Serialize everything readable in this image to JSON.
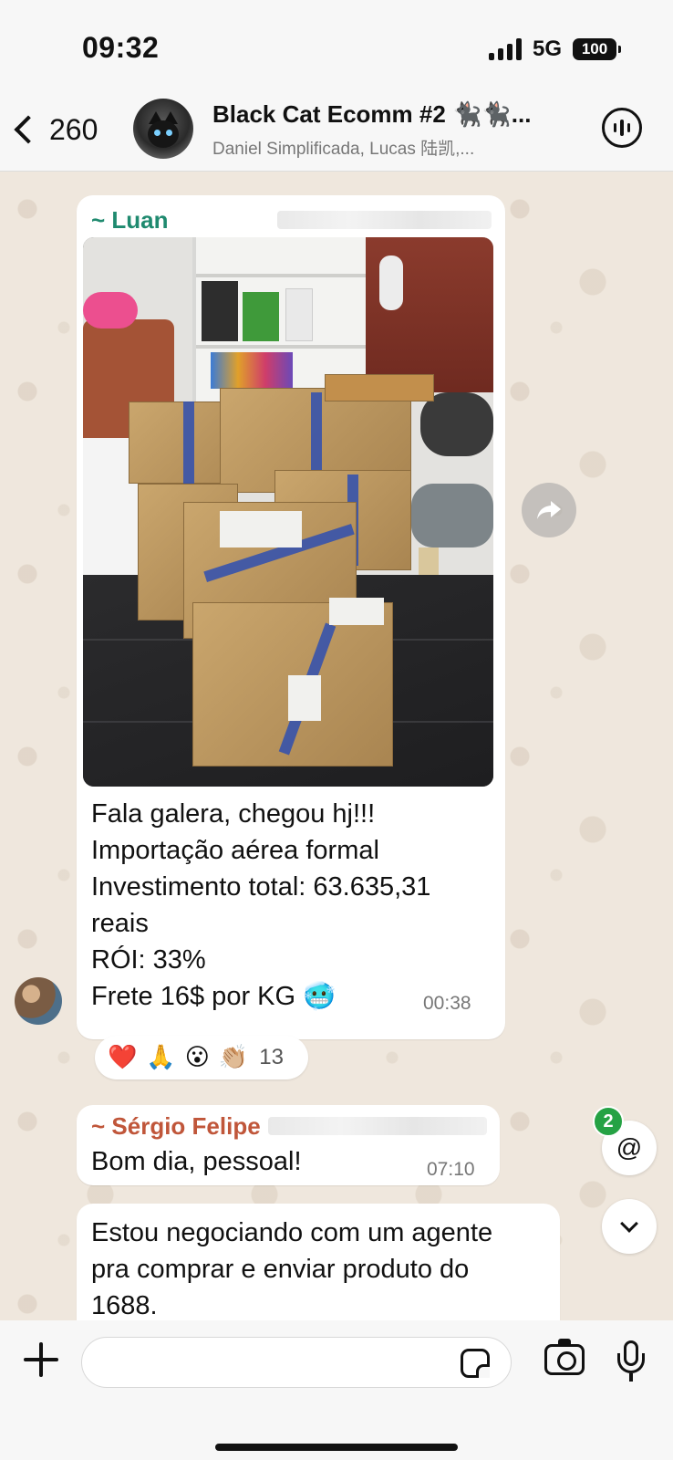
{
  "status_bar": {
    "time": "09:32",
    "network": "5G",
    "battery": "100"
  },
  "header": {
    "back_count": "260",
    "group_name": "Black Cat Ecomm #2 🐈‍⬛🐈‍⬛...",
    "members": "Daniel Simplificada, Lucas 陆凯,..."
  },
  "messages": [
    {
      "sender": "~ Luan",
      "sender_color": "#1f8a6f",
      "lines": [
        "Fala galera, chegou hj!!!",
        "Importação aérea formal",
        "Investimento total: 63.635,31",
        "reais",
        "RÓI: 33%",
        "Frete 16$ por KG 🥶"
      ],
      "time": "00:38",
      "has_photo": true
    },
    {
      "sender": "~ Sérgio Felipe",
      "sender_color": "#c0563a",
      "text": "Bom dia, pessoal!",
      "time": "07:10"
    },
    {
      "lines": [
        "Estou negociando com um agente",
        "pra comprar e enviar produto do",
        "1688."
      ]
    }
  ],
  "reactions": {
    "emojis": [
      "❤️",
      "🙏",
      "😮",
      "👏🏼"
    ],
    "count": "13"
  },
  "mention_badge": "2",
  "mention_symbol": "@",
  "input": {
    "placeholder": "",
    "value": ""
  },
  "icons": [
    "back-chevron-icon",
    "group-avatar",
    "voice-call-icon",
    "forward-icon",
    "mention-icon",
    "chevron-down-icon",
    "plus-icon",
    "sticker-icon",
    "camera-icon",
    "microphone-icon"
  ]
}
